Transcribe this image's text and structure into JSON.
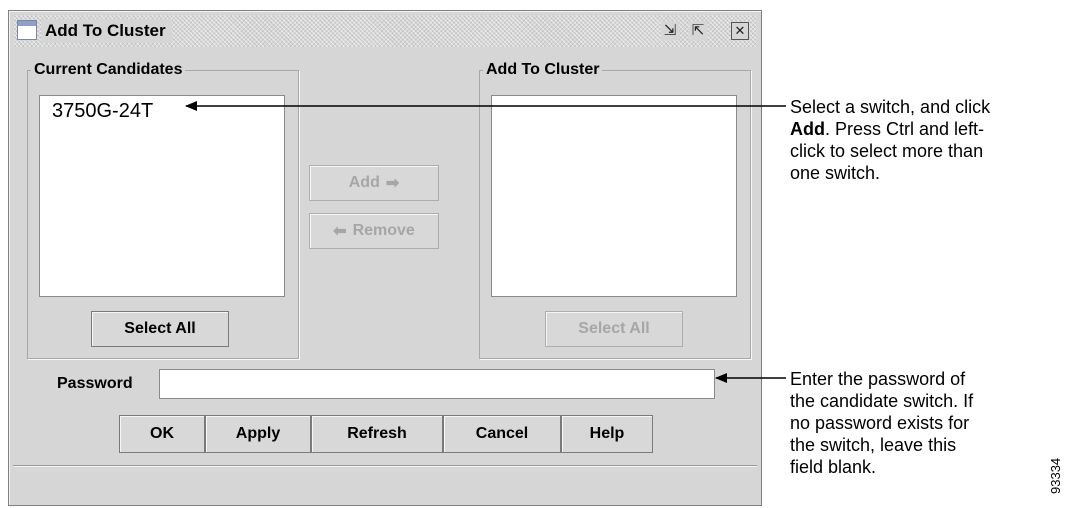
{
  "window": {
    "title": "Add To Cluster",
    "title_buttons": {
      "minimize": "minimize-icon",
      "maximize": "maximize-icon",
      "close": "close-icon"
    }
  },
  "candidates": {
    "legend": "Current Candidates",
    "items": [
      "3750G-24T"
    ],
    "select_all_label": "Select All"
  },
  "cluster": {
    "legend": "Add To Cluster",
    "items": [],
    "select_all_label": "Select All"
  },
  "transfer": {
    "add_label": "Add",
    "remove_label": "Remove"
  },
  "password": {
    "label": "Password",
    "value": ""
  },
  "actions": {
    "ok_label": "OK",
    "apply_label": "Apply",
    "refresh_label": "Refresh",
    "cancel_label": "Cancel",
    "help_label": "Help"
  },
  "annotations": {
    "select_line1": "Select a switch, and click",
    "select_bold": "Add",
    "select_line2_rest": ". Press Ctrl and left-",
    "select_line3": "click to select more than",
    "select_line4": "one switch.",
    "password_lines": [
      "Enter the password of",
      "the candidate switch. If",
      "no password exists for",
      "the switch, leave this",
      "field blank."
    ],
    "figure_id": "93334"
  },
  "colors": {
    "window_bg": "#d6d6d6",
    "disabled_text": "#a6a6a6"
  }
}
